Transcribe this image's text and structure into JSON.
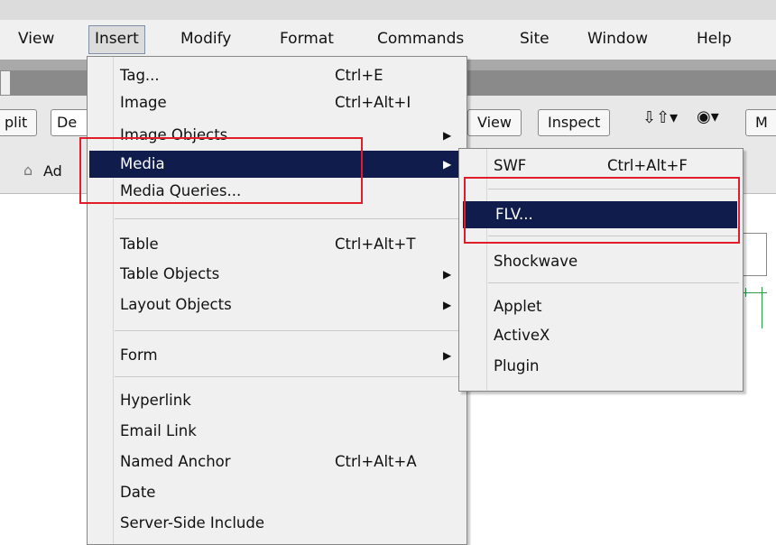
{
  "menubar": {
    "items": [
      "View",
      "Insert",
      "Modify",
      "Format",
      "Commands",
      "Site",
      "Window",
      "Help"
    ]
  },
  "toolbar": {
    "split": "plit",
    "design": "De",
    "view": "View",
    "inspect": "Inspect",
    "m": "M"
  },
  "address": {
    "text": "Ad"
  },
  "insert_menu": {
    "items": [
      {
        "label": "Tag...",
        "shortcut": "Ctrl+E"
      },
      {
        "label": "Image",
        "shortcut": "Ctrl+Alt+I"
      },
      {
        "label": "Image Objects"
      },
      {
        "label": "Media"
      },
      {
        "label": "Media Queries..."
      },
      {
        "label": "Table",
        "shortcut": "Ctrl+Alt+T"
      },
      {
        "label": "Table Objects"
      },
      {
        "label": "Layout Objects"
      },
      {
        "label": "Form"
      },
      {
        "label": "Hyperlink"
      },
      {
        "label": "Email Link"
      },
      {
        "label": "Named Anchor",
        "shortcut": "Ctrl+Alt+A"
      },
      {
        "label": "Date"
      },
      {
        "label": "Server-Side Include"
      }
    ]
  },
  "media_submenu": {
    "items": [
      {
        "label": "SWF",
        "shortcut": "Ctrl+Alt+F"
      },
      {
        "label": "FLV..."
      },
      {
        "label": "Shockwave"
      },
      {
        "label": "Applet"
      },
      {
        "label": "ActiveX"
      },
      {
        "label": "Plugin"
      }
    ]
  },
  "icons": {
    "submenu_arrow": "triangle-right-icon",
    "home": "home-icon",
    "updown": "arrows-updown-icon",
    "globe": "globe-icon"
  },
  "colors": {
    "highlight": "#101c4b",
    "annotation": "#e21d2b"
  }
}
